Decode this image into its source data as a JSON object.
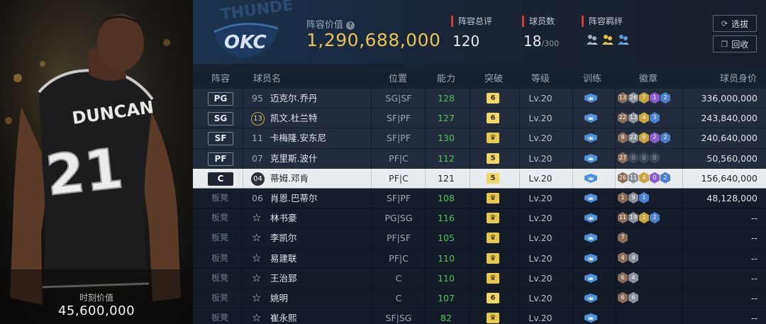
{
  "player_card": {
    "moment_label": "时刻价值",
    "moment_value": "45,600,000",
    "jersey_name": "DUNCAN",
    "jersey_number": "21"
  },
  "header": {
    "team_abbr": "OKC",
    "team_wordmark": "THUNDER",
    "roster_value_label": "阵容价值",
    "roster_value": "1,290,688,000",
    "overall_label": "阵容总评",
    "overall_value": "120",
    "players_label": "球员数",
    "players_value": "18",
    "players_max": "/300",
    "chemistry_label": "阵容羁绊",
    "chemistry_icons": [
      "people-icon",
      "people-icon",
      "people-icon"
    ],
    "draft_button": "选拔",
    "recycle_button": "回收"
  },
  "columns": {
    "lineup": "阵容",
    "name": "球员名",
    "position": "位置",
    "rating": "能力",
    "breakout": "突破",
    "level": "等级",
    "training": "训练",
    "badges": "徽章",
    "worth": "球员身价"
  },
  "rows": [
    {
      "slot": "PG",
      "type": "starter",
      "num": "95",
      "name": "迈克尔.乔丹",
      "position": "SG|SF",
      "rating": "128",
      "breakout": "6",
      "level": "Lv.20",
      "badges": [
        [
          "13",
          "bronze"
        ],
        [
          "26",
          "silver"
        ],
        [
          "7",
          "gold"
        ],
        [
          "1",
          "purple"
        ],
        [
          "2",
          "blue"
        ]
      ],
      "worth": "336,000,000"
    },
    {
      "slot": "SG",
      "type": "starter",
      "num": "13",
      "num_circle": true,
      "name": "凯文.杜兰特",
      "position": "SF|PF",
      "rating": "127",
      "breakout": "6",
      "level": "Lv.20",
      "badges": [
        [
          "22",
          "bronze"
        ],
        [
          "13",
          "silver"
        ],
        [
          "4",
          "gold"
        ],
        [
          "3",
          "blue"
        ]
      ],
      "worth": "243,840,000"
    },
    {
      "slot": "SF",
      "type": "starter",
      "num": "11",
      "name": "卡梅隆.安东尼",
      "position": "SF|PF",
      "rating": "130",
      "breakout": "crown",
      "level": "Lv.20",
      "badges": [
        [
          "8",
          "bronze"
        ],
        [
          "22",
          "silver"
        ],
        [
          "6",
          "gold"
        ],
        [
          "2",
          "purple"
        ],
        [
          "2",
          "blue"
        ]
      ],
      "worth": "240,640,000"
    },
    {
      "slot": "PF",
      "type": "starter",
      "num": "07",
      "name": "克里斯.波什",
      "position": "PF|C",
      "rating": "112",
      "breakout": "5",
      "level": "Lv.20",
      "badges": [
        [
          "27",
          "bronze"
        ],
        [
          "0",
          "dark"
        ],
        [
          "0",
          "dark"
        ],
        [
          "0",
          "dark"
        ]
      ],
      "worth": "50,560,000"
    },
    {
      "slot": "C",
      "type": "selected",
      "num": "04",
      "num_circle": true,
      "name": "蒂姆.邓肯",
      "position": "PF|C",
      "rating": "121",
      "breakout": "5",
      "level": "Lv.20",
      "badges": [
        [
          "26",
          "bronze"
        ],
        [
          "11",
          "silver"
        ],
        [
          "4",
          "gold"
        ],
        [
          "0",
          "purple"
        ],
        [
          "2",
          "blue"
        ]
      ],
      "worth": "156,640,000"
    },
    {
      "slot": "板凳",
      "type": "bench",
      "num": "06",
      "name": "肖恩.巴蒂尔",
      "position": "SF|PF",
      "rating": "108",
      "breakout": "crown",
      "level": "Lv.20",
      "badges": [
        [
          "1",
          "bronze"
        ],
        [
          "9",
          "silver"
        ],
        [
          "1",
          "blue"
        ]
      ],
      "worth": "48,128,000"
    },
    {
      "slot": "板凳",
      "type": "bench",
      "star": true,
      "name": "林书豪",
      "position": "PG|SG",
      "rating": "116",
      "breakout": "crown",
      "level": "Lv.20",
      "badges": [
        [
          "11",
          "bronze"
        ],
        [
          "19",
          "silver"
        ],
        [
          "1",
          "gold"
        ],
        [
          "2",
          "blue"
        ]
      ],
      "worth": "--"
    },
    {
      "slot": "板凳",
      "type": "bench",
      "star": true,
      "name": "李凯尔",
      "position": "PF|SF",
      "rating": "105",
      "breakout": "crown",
      "level": "Lv.20",
      "badges": [
        [
          "7",
          "bronze"
        ]
      ],
      "worth": "--"
    },
    {
      "slot": "板凳",
      "type": "bench",
      "star": true,
      "name": "易建联",
      "position": "PF|C",
      "rating": "110",
      "breakout": "crown",
      "level": "Lv.20",
      "badges": [
        [
          "4",
          "bronze"
        ],
        [
          "4",
          "silver"
        ]
      ],
      "worth": "--"
    },
    {
      "slot": "板凳",
      "type": "bench",
      "star": true,
      "name": "王治郅",
      "position": "C",
      "rating": "110",
      "breakout": "crown",
      "level": "Lv.20",
      "badges": [
        [
          "6",
          "bronze"
        ],
        [
          "4",
          "silver"
        ]
      ],
      "worth": "--"
    },
    {
      "slot": "板凳",
      "type": "bench",
      "star": true,
      "name": "姚明",
      "position": "C",
      "rating": "107",
      "breakout": "6",
      "level": "Lv.20",
      "badges": [
        [
          "6",
          "bronze"
        ],
        [
          "6",
          "silver"
        ]
      ],
      "worth": "--"
    },
    {
      "slot": "板凳",
      "type": "bench",
      "star": true,
      "name": "崔永熙",
      "position": "SF|SG",
      "rating": "82",
      "breakout": "crown",
      "level": "Lv.20",
      "badges": [],
      "worth": "--"
    }
  ],
  "colors": {
    "gold_value": "#e8c25a",
    "rating_green": "#57c05a",
    "accent_red": "#d23a3a",
    "breakout_yellow": "#f0d56b"
  }
}
